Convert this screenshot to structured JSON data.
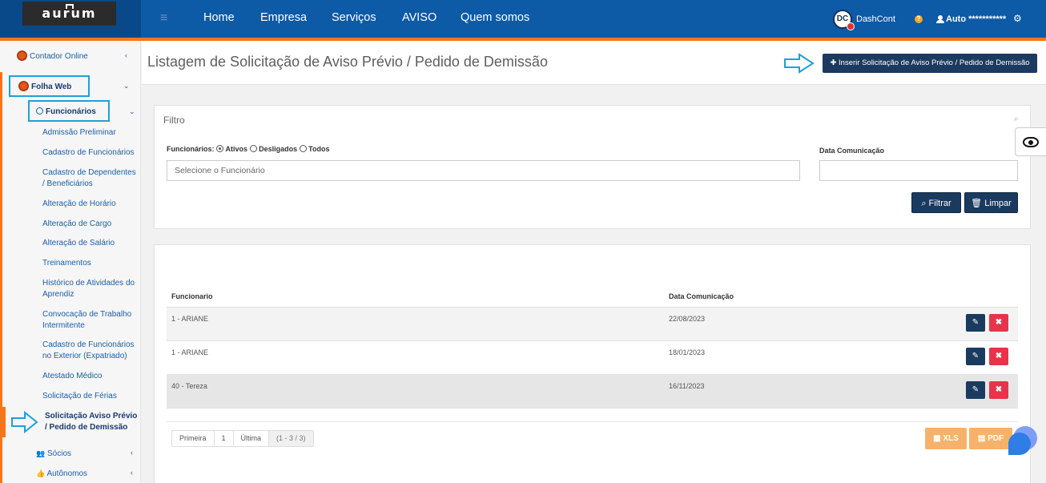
{
  "topbar": {
    "logo_text": "aurum",
    "nav": [
      "Home",
      "Empresa",
      "Serviços",
      "AVISO",
      "Quem somos"
    ],
    "dc_logo": "DC",
    "dashcont_label": "DashCont",
    "help": "?",
    "user_label": "Auto ***********"
  },
  "sidebar": {
    "contador_online": "Contador Online",
    "folha_web": "Folha Web",
    "funcionarios": "Funcionários",
    "sub_items": [
      "Admissão Preliminar",
      "Cadastro de Funcionários",
      "Cadastro de Dependentes / Beneficiários",
      "Alteração de Horário",
      "Alteração de Cargo",
      "Alteração de Salário",
      "Treinamentos",
      "Histórico de Atividades do Aprendiz",
      "Convocação de Trabalho Intermitente",
      "Cadastro de Funcionários no Exterior (Expatriado)",
      "Atestado Médico",
      "Solicitação de Férias"
    ],
    "active_item": "Solicitação Aviso Prévio / Pedido de Demissão",
    "socios": "Sócios",
    "autonomos": "Autônomos"
  },
  "page": {
    "title": "Listagem de Solicitação de Aviso Prévio / Pedido de Demissão",
    "insert_button": "Inserir Solicitação de Aviso Prévio / Pedido de Demissão"
  },
  "filter": {
    "title": "Filtro",
    "funcionarios_label": "Funcionários:",
    "radio_options": [
      "Ativos",
      "Desligados",
      "Todos"
    ],
    "selected_radio": "Ativos",
    "employee_placeholder": "Selecione o Funcionário",
    "date_label": "Data Comunicação",
    "date_value": "",
    "filter_button": "Filtrar",
    "clear_button": "Limpar"
  },
  "table": {
    "columns": [
      "Funcionario",
      "Data Comunicação"
    ],
    "rows": [
      {
        "funcionario": "1 - ARIANE",
        "data": "22/08/2023"
      },
      {
        "funcionario": "1 - ARIANE",
        "data": "18/01/2023"
      },
      {
        "funcionario": "40 - Tereza",
        "data": "16/11/2023"
      }
    ]
  },
  "pager": {
    "first": "Primeira",
    "page": "1",
    "last": "Última",
    "range": "(1 - 3 / 3)"
  },
  "export": {
    "xls": "XLS",
    "pdf": "PDF"
  },
  "colors": {
    "topbar": "#0d5aa7",
    "accent_orange": "#f5761a",
    "dark_button": "#1b3a5f",
    "delete_red": "#e8334a",
    "export_orange": "#f6b26b"
  }
}
